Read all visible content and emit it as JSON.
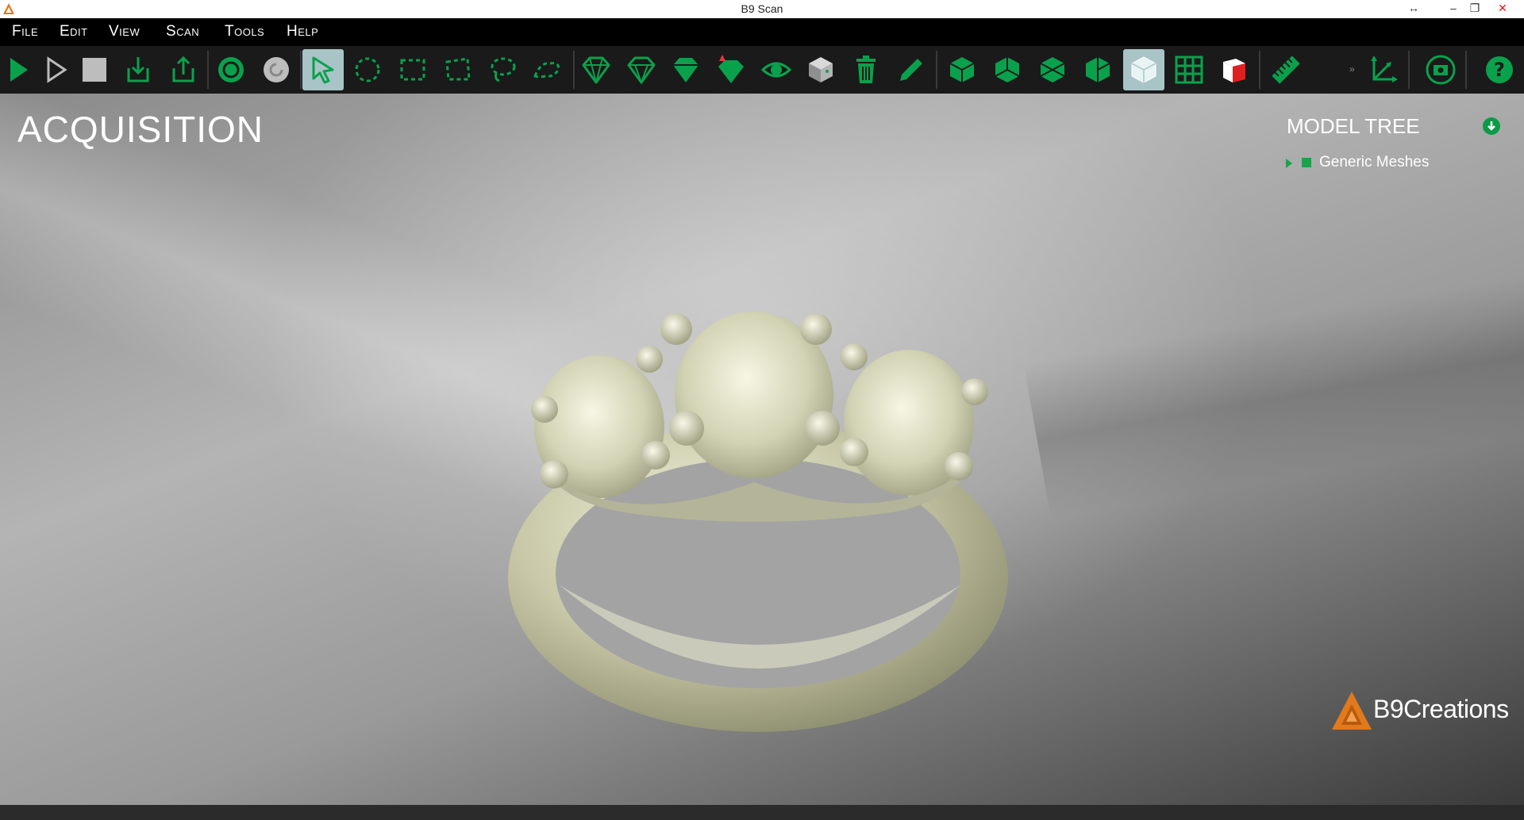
{
  "window": {
    "title": "B9 Scan",
    "controls": {
      "resize": "↔",
      "minimize": "–",
      "restore": "❐",
      "close": "✕"
    },
    "close_color": "#e81123"
  },
  "menu": [
    {
      "label": "File"
    },
    {
      "label": "Edit"
    },
    {
      "label": "View"
    },
    {
      "label": "Scan"
    },
    {
      "label": "Tools"
    },
    {
      "label": "Help"
    }
  ],
  "toolbar": {
    "accent": "#0aa14c",
    "groups": [
      [
        "play-icon",
        "play-outline-icon",
        "stop-icon",
        "import-icon",
        "export-icon"
      ],
      [
        "target-icon",
        "refresh-icon"
      ],
      [
        "select-arrow-icon",
        "ellipse-select-icon",
        "rect-select-icon",
        "poly-select-icon",
        "lasso-select-icon",
        "freeform-select-icon"
      ],
      [
        "gem-outline-icon",
        "gem-icon",
        "gem-filled-icon",
        "gem-marker-icon",
        "eye-icon",
        "cube-color-icon",
        "trash-icon",
        "pencil-icon"
      ],
      [
        "view-iso-icon",
        "view-front-icon",
        "view-top-icon",
        "view-side-icon",
        "view-shaded-icon",
        "grid-icon",
        "cube-red-icon"
      ],
      [
        "ruler-icon"
      ],
      [
        "axes-icon"
      ],
      [
        "screenshot-icon"
      ],
      [
        "help-icon"
      ]
    ],
    "active": [
      "select-arrow-icon",
      "view-shaded-icon"
    ]
  },
  "viewport": {
    "mode_title": "ACQUISITION",
    "model_tree": {
      "title": "MODEL TREE",
      "items": [
        {
          "label": "Generic Meshes",
          "checked": true,
          "expanded": false
        }
      ]
    },
    "brand": {
      "name": "B9Creations",
      "logo_color": "#e07a1c"
    }
  }
}
